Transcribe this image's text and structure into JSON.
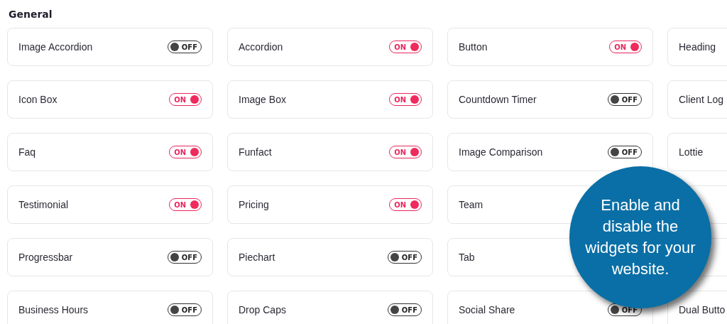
{
  "section": {
    "title": "General"
  },
  "rows": [
    [
      {
        "label": "Image Accordion",
        "on": false,
        "toggle_text": "OFF"
      },
      {
        "label": "Accordion",
        "on": true,
        "toggle_text": "ON"
      },
      {
        "label": "Button",
        "on": true,
        "toggle_text": "ON"
      },
      {
        "label": "Heading"
      }
    ],
    [
      {
        "label": "Icon Box",
        "on": true,
        "toggle_text": "ON"
      },
      {
        "label": "Image Box",
        "on": true,
        "toggle_text": "ON"
      },
      {
        "label": "Countdown Timer",
        "on": false,
        "toggle_text": "OFF"
      },
      {
        "label": "Client Log"
      }
    ],
    [
      {
        "label": "Faq",
        "on": true,
        "toggle_text": "ON"
      },
      {
        "label": "Funfact",
        "on": true,
        "toggle_text": "ON"
      },
      {
        "label": "Image Comparison",
        "on": false,
        "toggle_text": "OFF"
      },
      {
        "label": "Lottie"
      }
    ],
    [
      {
        "label": "Testimonial",
        "on": true,
        "toggle_text": "ON"
      },
      {
        "label": "Pricing",
        "on": true,
        "toggle_text": "ON"
      },
      {
        "label": "Team"
      },
      null
    ],
    [
      {
        "label": "Progressbar",
        "on": false,
        "toggle_text": "OFF"
      },
      {
        "label": "Piechart",
        "on": false,
        "toggle_text": "OFF"
      },
      {
        "label": "Tab"
      },
      null
    ],
    [
      {
        "label": "Business Hours",
        "on": false,
        "toggle_text": "OFF"
      },
      {
        "label": "Drop Caps",
        "on": false,
        "toggle_text": "OFF"
      },
      {
        "label": "Social Share",
        "on": false,
        "toggle_text": "OFF"
      },
      {
        "label": "Dual Butto"
      }
    ]
  ],
  "callout": {
    "text": "Enable and disable the widgets for your website."
  }
}
